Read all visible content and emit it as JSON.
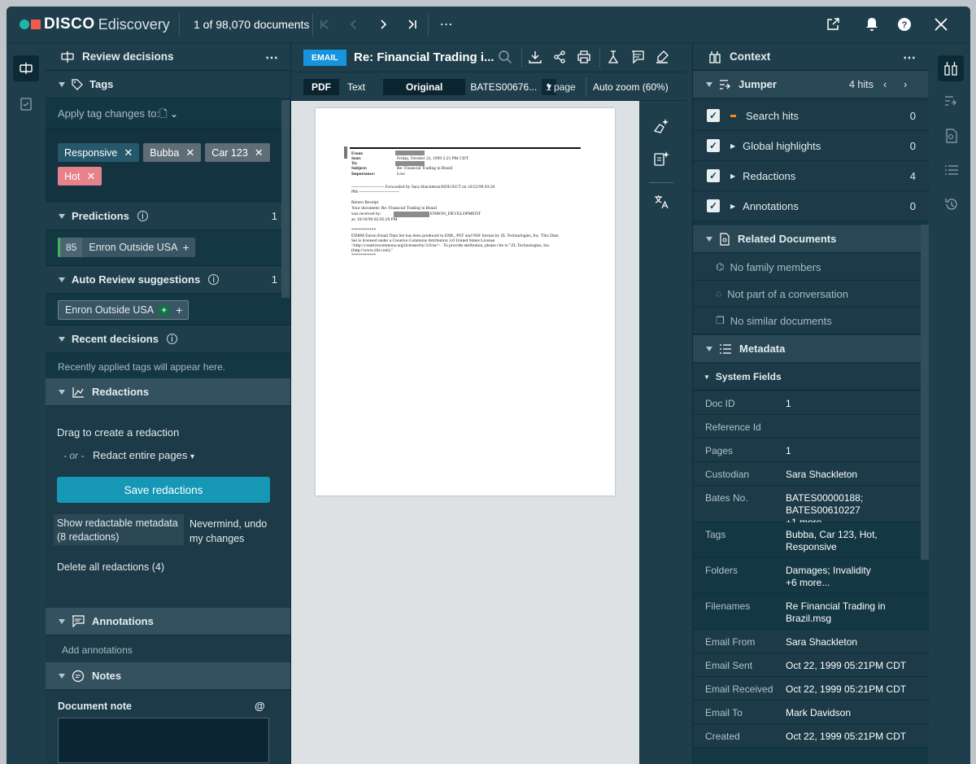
{
  "app": {
    "brand": "DISCO",
    "product": "Ediscovery",
    "doc_counter": "1 of 98,070 documents"
  },
  "left": {
    "title": "Review decisions",
    "tags": {
      "header": "Tags",
      "apply_label": "Apply tag changes to:",
      "chips": [
        {
          "label": "Responsive",
          "color": "#25586b"
        },
        {
          "label": "Bubba",
          "color": "#5f6d77"
        },
        {
          "label": "Car 123",
          "color": "#5f6d77"
        },
        {
          "label": "Hot",
          "color": "#e7828a"
        }
      ]
    },
    "predictions": {
      "header": "Predictions",
      "count": "1",
      "score": "85",
      "label": "Enron Outside USA"
    },
    "auto_review": {
      "header": "Auto Review suggestions",
      "count": "1",
      "label": "Enron Outside USA"
    },
    "recent": {
      "header": "Recent decisions",
      "empty": "Recently applied tags will appear here."
    },
    "redactions": {
      "header": "Redactions",
      "drag": "Drag to create a redaction",
      "or": "- or -",
      "entire": "Redact entire pages",
      "save": "Save redactions",
      "show_meta": "Show redactable metadata (8 redactions)",
      "nevermind": "Nevermind, undo my changes",
      "delete_all": "Delete all redactions (4)"
    },
    "annotations": {
      "header": "Annotations",
      "add": "Add annotations"
    },
    "notes": {
      "header": "Notes",
      "doc_note": "Document note",
      "at": "@"
    }
  },
  "viewer": {
    "badge": "EMAIL",
    "subject": "Re: Financial Trading i...",
    "tabs": [
      "PDF",
      "Text"
    ],
    "mode": "Original",
    "bates": "BATES00676...",
    "pages": "1 page",
    "zoom": "Auto zoom (60%)",
    "doc_lines": {
      "from": "From:",
      "sent": "Sent:",
      "to": "To:",
      "subject": "Subject:",
      "importance": "Importance:",
      "sent_val": "Friday, October 22, 1999 5:21 PM CDT",
      "subject_val": "Re: Financial Trading in Brazil",
      "importance_val": "Low",
      "fwd": "---------------------- Forwarded by Sara Shackleton/HOU/ECT on 10/22/99 03:20",
      "pm": "PM ---------------------------",
      "rr": "Return Receipt",
      "yd": "Your document:  Re: Financial Trading in Brazil",
      "wrb": "was received by:",
      "wrb_val": "ENRON_DEVELOPMENT",
      "at": "at:     10/19/99 02:05:29 PM",
      "stars": "***********",
      "e1": "EDRM Enron Email Data Set has been produced in EML, PST and NSF format by ZL Technologies, Inc. This Data",
      "e2": "Set is licensed under a Creative Commons Attribution 3.0 United States License",
      "e3": "<http://creativecommons.org/licenses/by/3.0/us/> . To provide attribution, please cite to \"ZL Technologies, Inc.",
      "e4": "(http://www.zlti.com).\"",
      "stars2": "***********"
    }
  },
  "right": {
    "title": "Context",
    "jumper": {
      "header": "Jumper",
      "hits": "4 hits",
      "items": [
        {
          "label": "Search hits",
          "count": "0"
        },
        {
          "label": "Global highlights",
          "count": "0"
        },
        {
          "label": "Redactions",
          "count": "4"
        },
        {
          "label": "Annotations",
          "count": "0"
        }
      ]
    },
    "related": {
      "header": "Related Documents",
      "family": "No family members",
      "conversation": "Not part of a conversation",
      "similar": "No similar documents"
    },
    "metadata": {
      "header": "Metadata",
      "system": "System Fields",
      "fields": [
        {
          "k": "Doc ID",
          "v": "1"
        },
        {
          "k": "Reference Id",
          "v": ""
        },
        {
          "k": "Pages",
          "v": "1"
        },
        {
          "k": "Custodian",
          "v": "Sara Shackleton"
        },
        {
          "k": "Bates No.",
          "v1": "BATES00000188;",
          "v2": "BATES00610227",
          "v3": "+1 more..."
        },
        {
          "k": "Tags",
          "v1": "Bubba, Car 123, Hot,",
          "v2": "Responsive"
        },
        {
          "k": "Folders",
          "v1": "Damages; Invalidity",
          "v2": "+6 more..."
        },
        {
          "k": "Filenames",
          "v1": "Re Financial Trading in",
          "v2": "Brazil.msg"
        },
        {
          "k": "Email From",
          "v": "Sara Shackleton"
        },
        {
          "k": "Email Sent",
          "v": "Oct 22, 1999 05:21PM CDT"
        },
        {
          "k": "Email Received",
          "v": "Oct 22, 1999 05:21PM CDT"
        },
        {
          "k": "Email To",
          "v": "Mark Davidson"
        },
        {
          "k": "Created",
          "v": "Oct 22, 1999 05:21PM CDT"
        }
      ]
    }
  }
}
